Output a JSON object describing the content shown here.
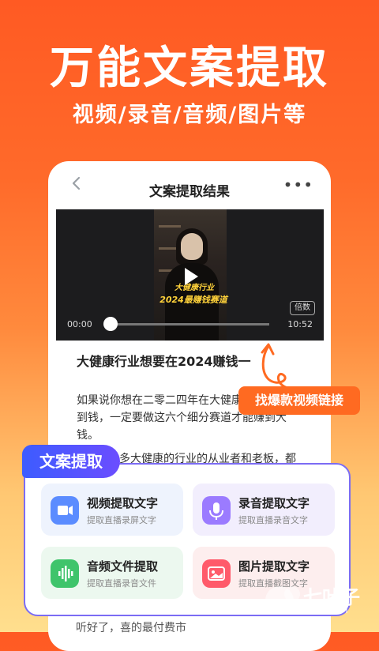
{
  "hero": {
    "title": "万能文案提取",
    "subtitle": "视频/录音/音频/图片等"
  },
  "nav": {
    "title": "文案提取结果",
    "back_icon": "chevron-left-icon",
    "more_icon": "more-horizontal-icon",
    "more_glyph": "•••"
  },
  "video": {
    "caption_top": "大健康行业",
    "caption_bottom": "2024最赚钱赛道",
    "speed_label": "倍数",
    "current_time": "00:00",
    "total_time": "10:52",
    "progress": 0.0
  },
  "article": {
    "title": "大健康行业想要在2024赚钱一",
    "paragraphs": [
      "如果说你想在二零二四年在大健康",
      "到钱，一定要做这六个细分赛道才能赚到大",
      "钱。",
      "多大健康的行业的从业者和老板，都"
    ],
    "bottom_peek": "听好了，喜的最付费市"
  },
  "tag": {
    "label": "找爆款视频链接"
  },
  "panel": {
    "tab_label": "文案提取",
    "cards": [
      {
        "label": "视频提取文字",
        "sub": "提取直播录屏文字",
        "icon": "video-camera-icon",
        "color": "#5b8cff",
        "bg": "#eef3fd"
      },
      {
        "label": "录音提取文字",
        "sub": "提取直播录音文字",
        "icon": "microphone-icon",
        "color": "#9b7bff",
        "bg": "#f2eefd"
      },
      {
        "label": "音频文件提取",
        "sub": "提取直播录音文件",
        "icon": "audio-file-icon",
        "color": "#3fc46b",
        "bg": "#ecf8ef"
      },
      {
        "label": "图片提取文字",
        "sub": "提取直播截图文字",
        "icon": "image-icon",
        "color": "#ff5a6a",
        "bg": "#fdeeee"
      }
    ]
  },
  "watermark": {
    "text": "七叶子",
    "url": "7YZ.COM"
  },
  "colors": {
    "accent": "#ff6a21",
    "panel_border": "#7b6cf4"
  }
}
